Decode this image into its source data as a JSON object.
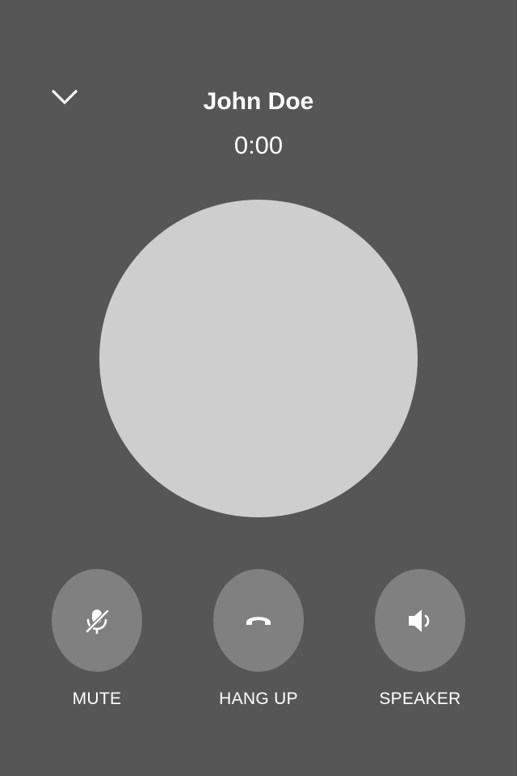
{
  "header": {
    "collapse_icon": "chevron-down-icon",
    "caller_name": "John Doe",
    "call_timer": "0:00"
  },
  "avatar": {
    "color": "#cecece"
  },
  "controls": [
    {
      "id": "mute",
      "label": "MUTE",
      "icon": "microphone-off-icon"
    },
    {
      "id": "hangup",
      "label": "HANG UP",
      "icon": "phone-hangup-icon"
    },
    {
      "id": "speaker",
      "label": "SPEAKER",
      "icon": "speaker-icon"
    }
  ],
  "colors": {
    "background": "#565656",
    "button": "#808080",
    "text": "#ffffff"
  }
}
